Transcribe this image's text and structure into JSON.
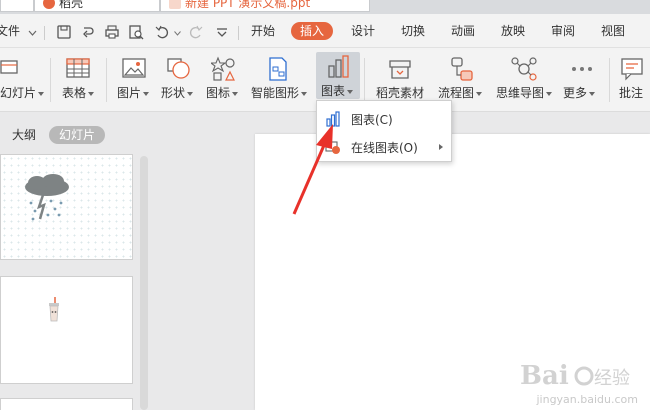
{
  "title_tabs": [
    {
      "label": "稻壳"
    },
    {
      "label": "新建 PPT 演示文稿.ppt"
    }
  ],
  "menu": {
    "file": "文件",
    "items": [
      "开始",
      "插入",
      "设计",
      "切换",
      "动画",
      "放映",
      "审阅",
      "视图"
    ],
    "active": "插入"
  },
  "ribbon": {
    "new_slide": "幻灯片",
    "table": "表格",
    "picture": "图片",
    "shape": "形状",
    "icon": "图标",
    "smartart": "智能图形",
    "chart": "图表",
    "docer_material": "稻壳素材",
    "flowchart": "流程图",
    "mindmap": "思维导图",
    "more": "更多",
    "comment": "批注"
  },
  "left_panel": {
    "tab_outline": "大纲",
    "tab_slides": "幻灯片"
  },
  "dropdown": {
    "items": [
      {
        "label": "图表(C)",
        "has_submenu": false
      },
      {
        "label": "在线图表(O)",
        "has_submenu": true
      }
    ]
  },
  "watermark": {
    "url": "jingyan.baidu.com"
  },
  "colors": {
    "accent": "#e6663f",
    "arrow": "#e8312a",
    "chart_icon_blue": "#2f6fd1",
    "chart_icon_orange": "#e6663f"
  }
}
